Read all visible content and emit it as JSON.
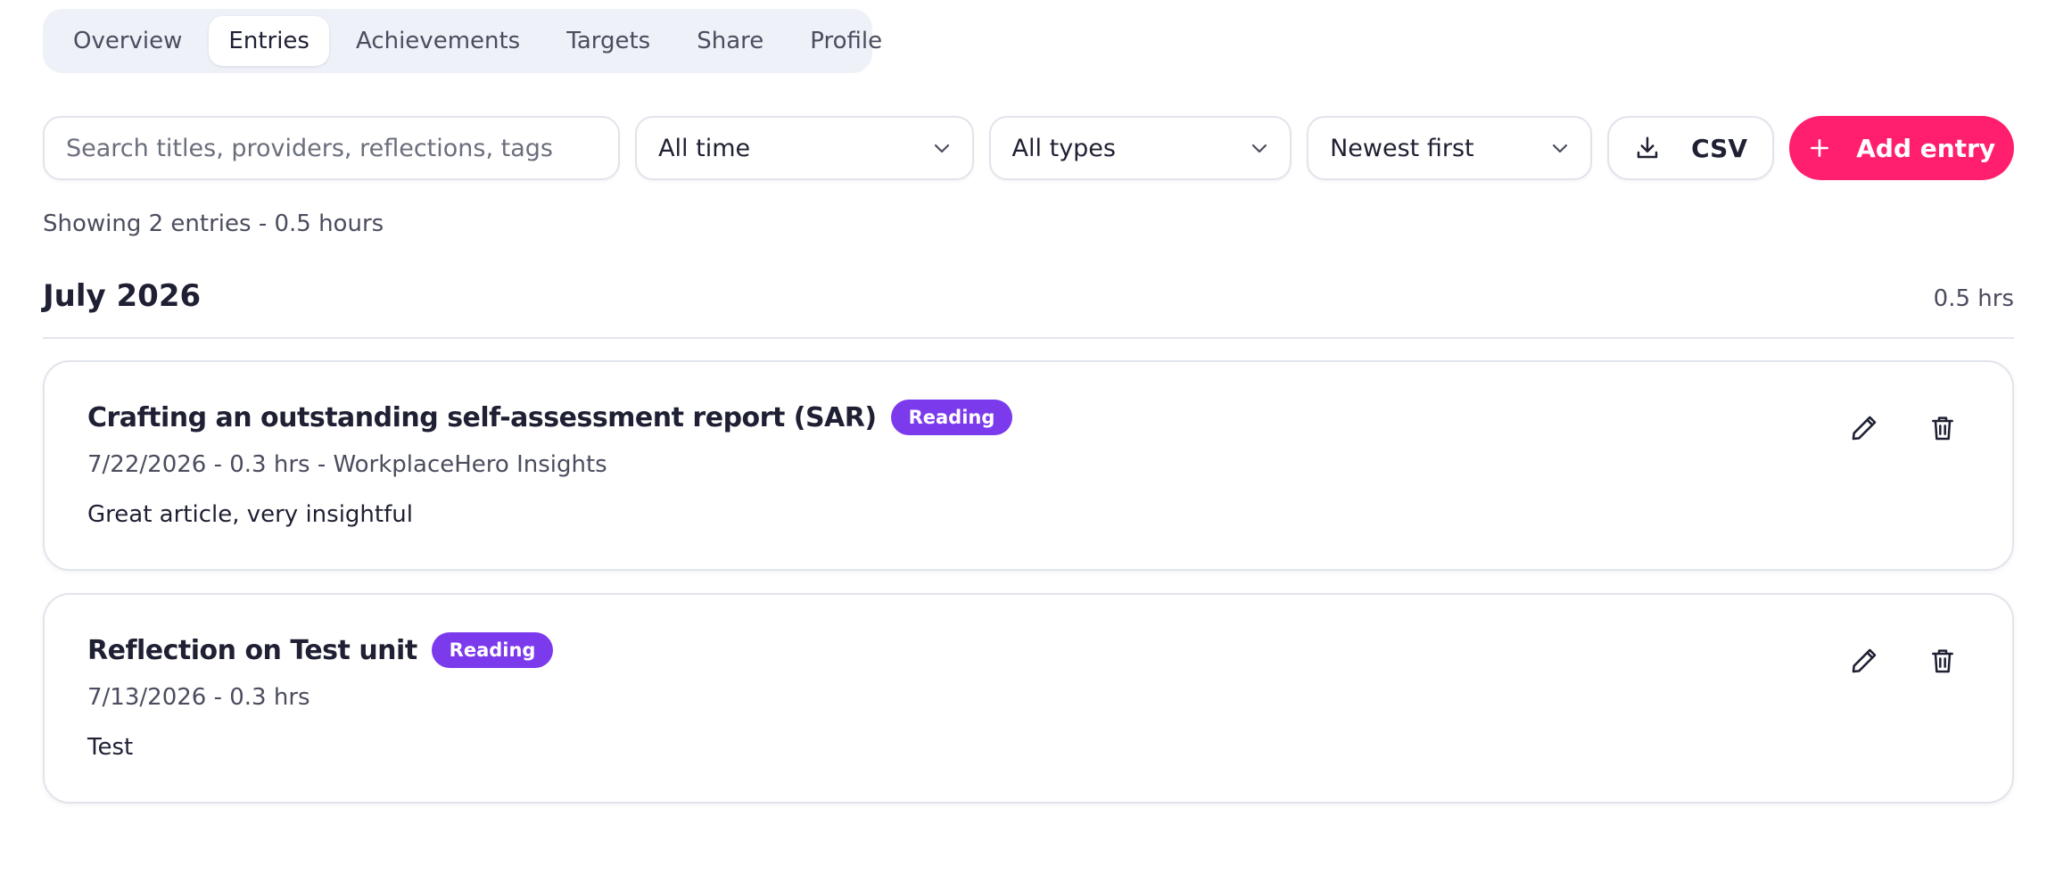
{
  "tabs": [
    {
      "label": "Overview",
      "active": false
    },
    {
      "label": "Entries",
      "active": true
    },
    {
      "label": "Achievements",
      "active": false
    },
    {
      "label": "Targets",
      "active": false
    },
    {
      "label": "Share",
      "active": false
    },
    {
      "label": "Profile",
      "active": false
    }
  ],
  "toolbar": {
    "search_placeholder": "Search titles, providers, reflections, tags",
    "time_filter": "All time",
    "type_filter": "All types",
    "sort": "Newest first",
    "csv_label": "CSV",
    "add_label": "Add entry"
  },
  "summary": "Showing 2 entries - 0.5 hours",
  "month": {
    "title": "July 2026",
    "hours": "0.5 hrs"
  },
  "entries": [
    {
      "title": "Crafting an outstanding self-assessment report (SAR)",
      "badge": "Reading",
      "meta": "7/22/2026 - 0.3 hrs - WorkplaceHero Insights",
      "note": "Great article, very insightful"
    },
    {
      "title": "Reflection on Test unit",
      "badge": "Reading",
      "meta": "7/13/2026 - 0.3 hrs",
      "note": "Test"
    }
  ],
  "colors": {
    "accent": "#ff1f6e",
    "badge": "#7c3aed",
    "tabs_bg": "#eef1f8"
  },
  "icons": {
    "chevron": "chevron-down-icon",
    "download": "download-icon",
    "plus": "plus-icon",
    "edit": "pencil-icon",
    "delete": "trash-icon"
  }
}
